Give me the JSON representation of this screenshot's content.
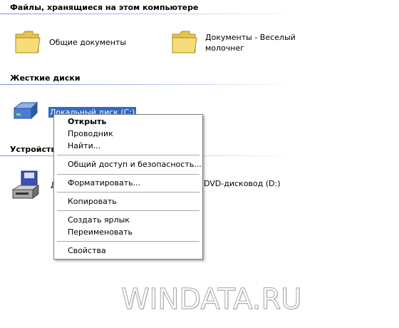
{
  "groups": {
    "stored_files": "Файлы, хранящиеся на этом компьютере",
    "hard_disks": "Жесткие диски",
    "removable": "Устройства"
  },
  "items": {
    "shared_docs": "Общие документы",
    "user_docs_line1": "Документы - Веселый",
    "user_docs_line2": "молочнег",
    "local_disk": "Локальный диск (C:)",
    "floppy_partial": "Д",
    "dvd_drive": "DVD-дисковод (D:)"
  },
  "context_menu": {
    "open": "Открыть",
    "explorer": "Проводник",
    "find": "Найти...",
    "sharing": "Общий доступ и безопасность...",
    "format": "Форматировать...",
    "copy": "Копировать",
    "create_shortcut": "Создать ярлык",
    "rename": "Переименовать",
    "properties": "Свойства"
  },
  "watermark": "WINDATA.RU",
  "colors": {
    "selection": "#316ac5",
    "header_line": "#7a96df",
    "folder": "#f3d66e"
  }
}
